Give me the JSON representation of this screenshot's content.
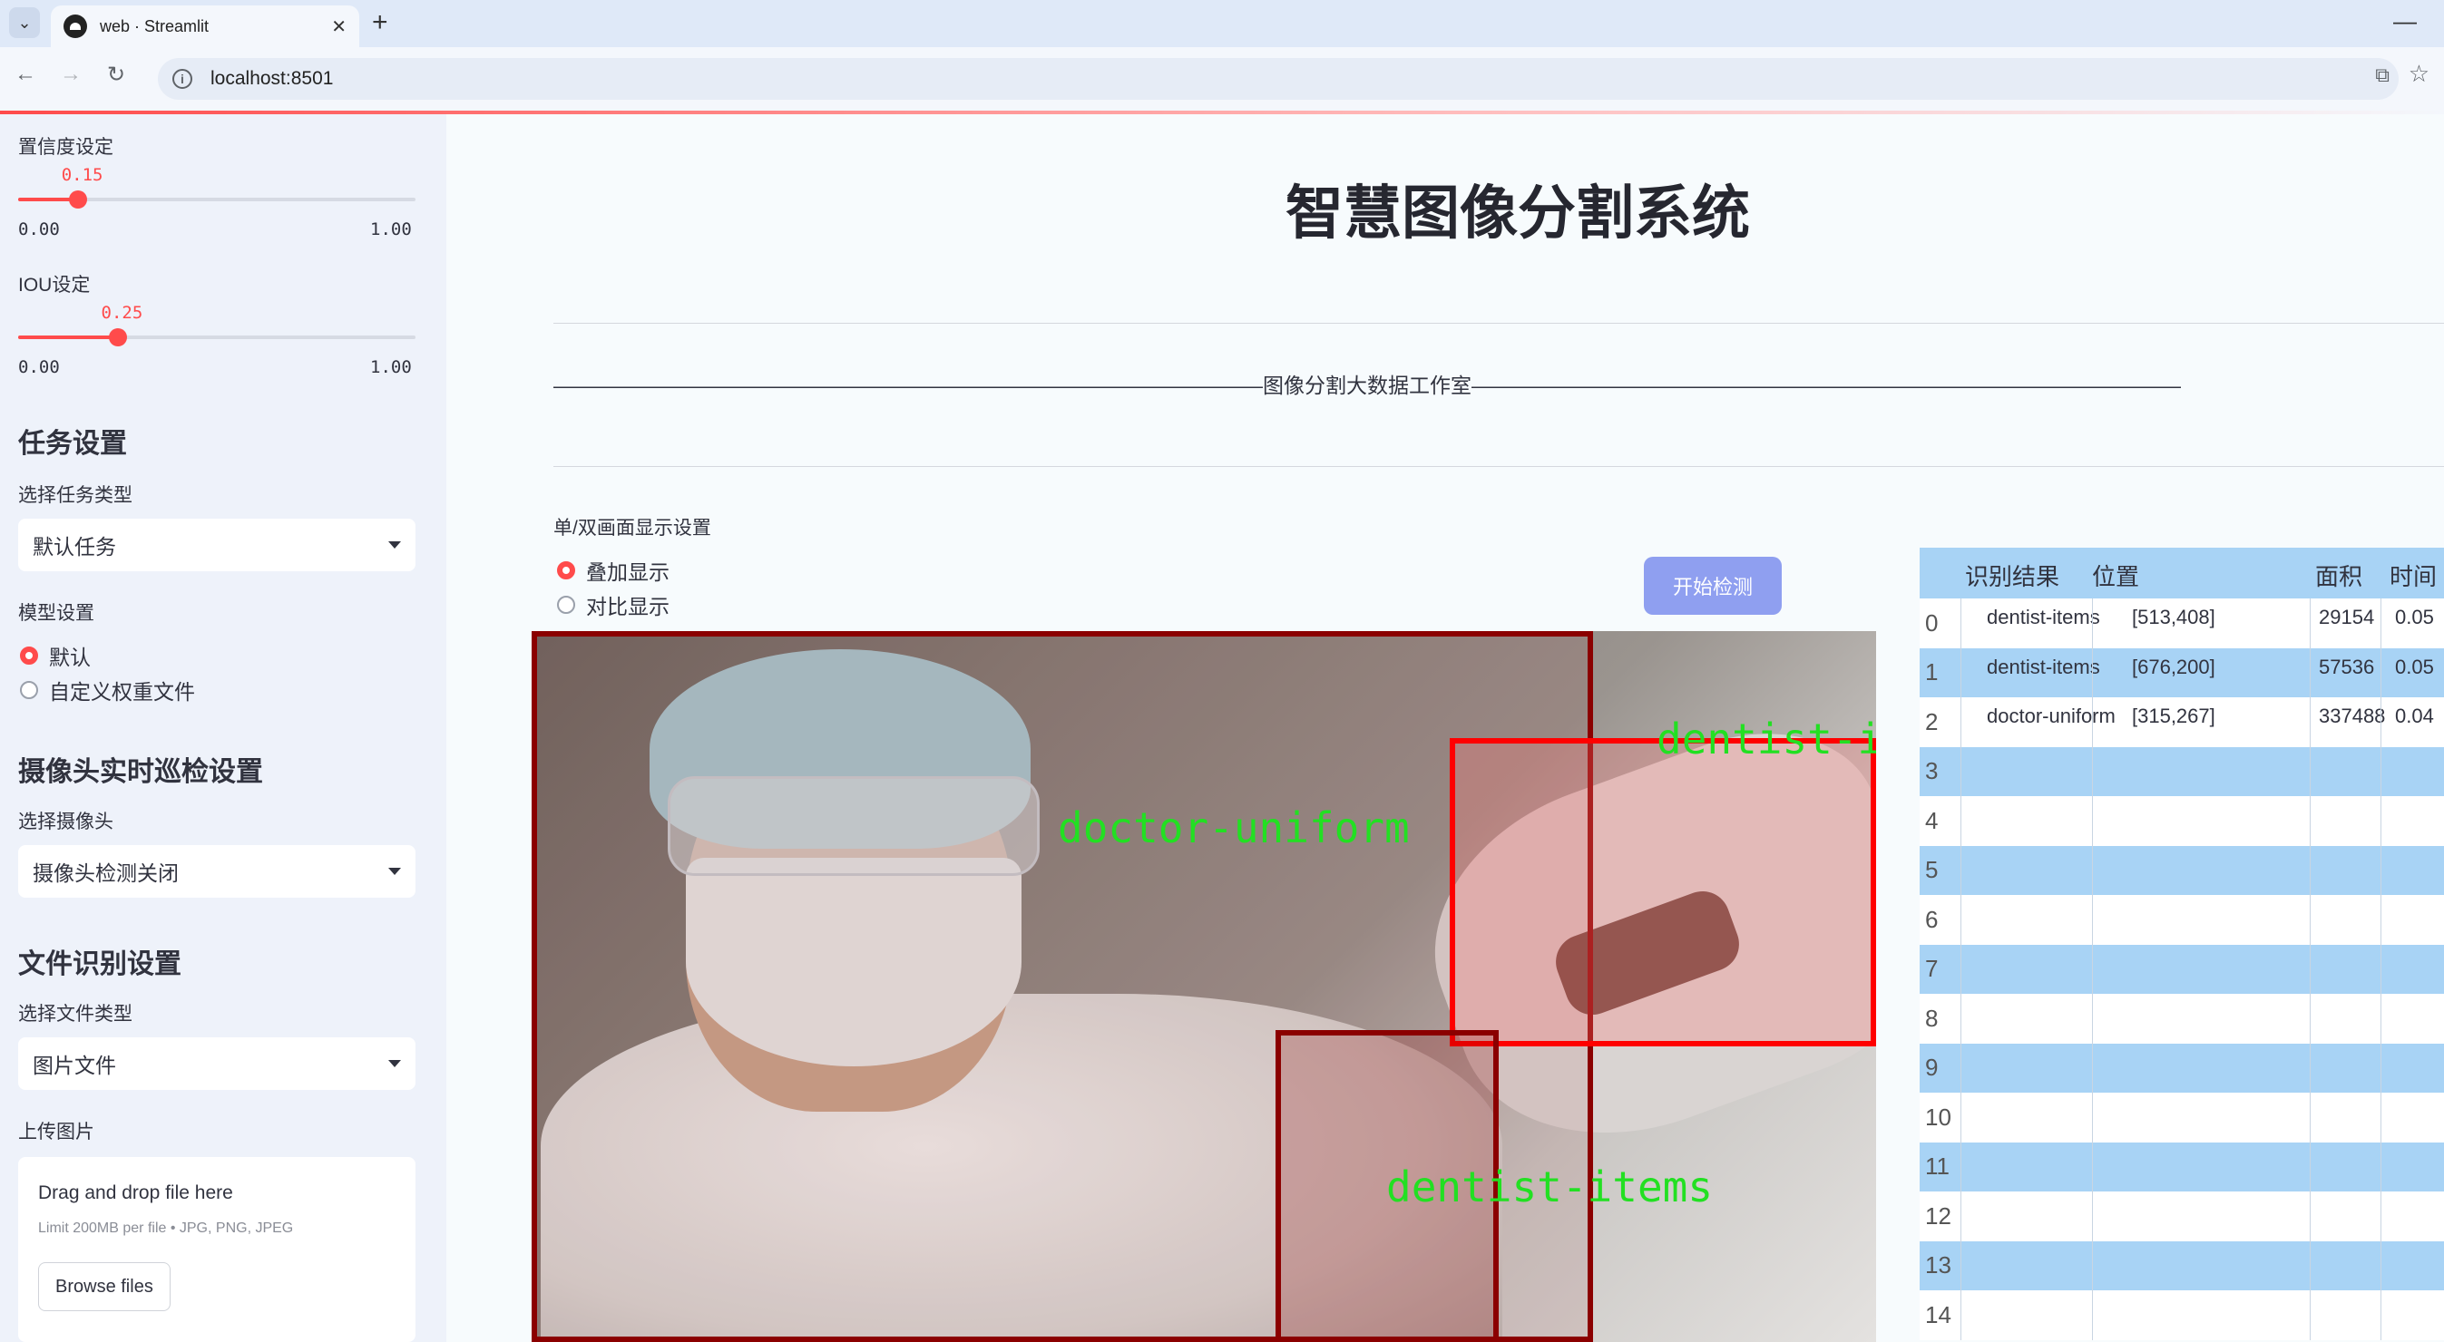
{
  "browser": {
    "tab_title": "web · Streamlit",
    "url": "localhost:8501",
    "new_tab": "+",
    "close": "✕",
    "minimize": "—"
  },
  "sidebar": {
    "confidence": {
      "label": "置信度设定",
      "value": "0.15",
      "min": "0.00",
      "max": "1.00",
      "fraction": 0.15
    },
    "iou": {
      "label": "IOU设定",
      "value": "0.25",
      "min": "0.00",
      "max": "1.00",
      "fraction": 0.25
    },
    "task_heading": "任务设置",
    "task_type_label": "选择任务类型",
    "task_type_value": "默认任务",
    "model_label": "模型设置",
    "model_options": [
      "默认",
      "自定义权重文件"
    ],
    "model_selected": 0,
    "camera_heading": "摄像头实时巡检设置",
    "camera_label": "选择摄像头",
    "camera_value": "摄像头检测关闭",
    "file_heading": "文件识别设置",
    "file_type_label": "选择文件类型",
    "file_type_value": "图片文件",
    "upload_label": "上传图片",
    "upload_main": "Drag and drop file here",
    "upload_sub": "Limit 200MB per file • JPG, PNG, JPEG",
    "browse_label": "Browse files"
  },
  "main": {
    "title": "智慧图像分割系统",
    "divider_text": "——————————————————————————————————图像分割大数据工作室——————————————————————————————————",
    "display_label": "单/双画面显示设置",
    "display_options": [
      "叠加显示",
      "对比显示"
    ],
    "display_selected": 0,
    "start_button": "开始检测"
  },
  "detections": [
    {
      "label": "doctor-uniform",
      "color": "#8b0000"
    },
    {
      "label": "dentist-items",
      "color": "#ff0000"
    },
    {
      "label": "dentist-items",
      "color": "#8b0000"
    }
  ],
  "table": {
    "headers": [
      "识别结果",
      "位置",
      "面积",
      "时间"
    ],
    "rows": [
      {
        "index": "0",
        "result": "dentist-items",
        "position": "[513,408]",
        "area": "29154",
        "time": "0.05"
      },
      {
        "index": "1",
        "result": "dentist-items",
        "position": "[676,200]",
        "area": "57536",
        "time": "0.05"
      },
      {
        "index": "2",
        "result": "doctor-uniform",
        "position": "[315,267]",
        "area": "337488",
        "time": "0.04"
      },
      {
        "index": "3"
      },
      {
        "index": "4"
      },
      {
        "index": "5"
      },
      {
        "index": "6"
      },
      {
        "index": "7"
      },
      {
        "index": "8"
      },
      {
        "index": "9"
      },
      {
        "index": "10"
      },
      {
        "index": "11"
      },
      {
        "index": "12"
      },
      {
        "index": "13"
      },
      {
        "index": "14"
      }
    ]
  }
}
